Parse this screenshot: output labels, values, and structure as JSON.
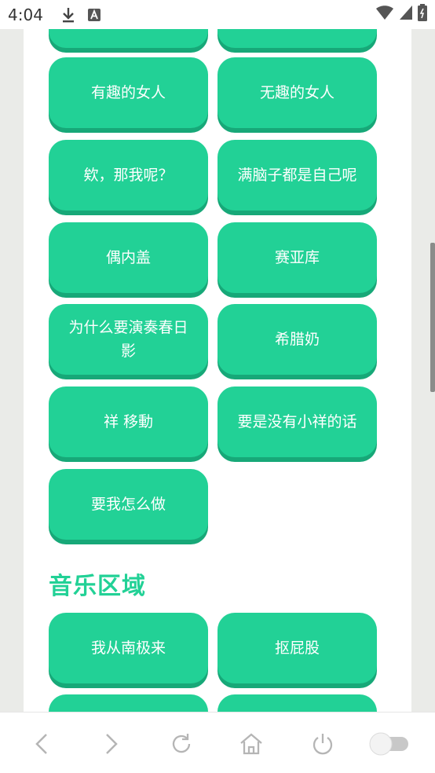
{
  "status_bar": {
    "time": "4:04",
    "icons": [
      "download-icon",
      "text-a-icon",
      "wifi-icon",
      "signal-icon",
      "battery-icon"
    ]
  },
  "buttons_top_partial": [
    {
      "label": ""
    },
    {
      "label": ""
    }
  ],
  "buttons": [
    {
      "label": "有趣的女人"
    },
    {
      "label": "无趣的女人"
    },
    {
      "label": "欸，那我呢？"
    },
    {
      "label": "满脑子都是自己呢"
    },
    {
      "label": "偶内盖"
    },
    {
      "label": "赛亚库"
    },
    {
      "label": "为什么要演奏春日影"
    },
    {
      "label": "希腊奶"
    },
    {
      "label": "祥 移動"
    },
    {
      "label": "要是没有小祥的话"
    },
    {
      "label": "要我怎么做"
    }
  ],
  "music_section": {
    "title": "音乐区域",
    "buttons": [
      {
        "label": "我从南极来"
      },
      {
        "label": "抠屁股"
      },
      {
        "label": ""
      },
      {
        "label": ""
      }
    ]
  },
  "bottom_nav": {
    "icons": [
      "back-icon",
      "forward-icon",
      "reload-icon",
      "home-icon",
      "power-icon",
      "toggle-switch"
    ]
  },
  "colors": {
    "button": "#22d196",
    "button_shadow": "#17a878",
    "section_title": "#22d196"
  }
}
